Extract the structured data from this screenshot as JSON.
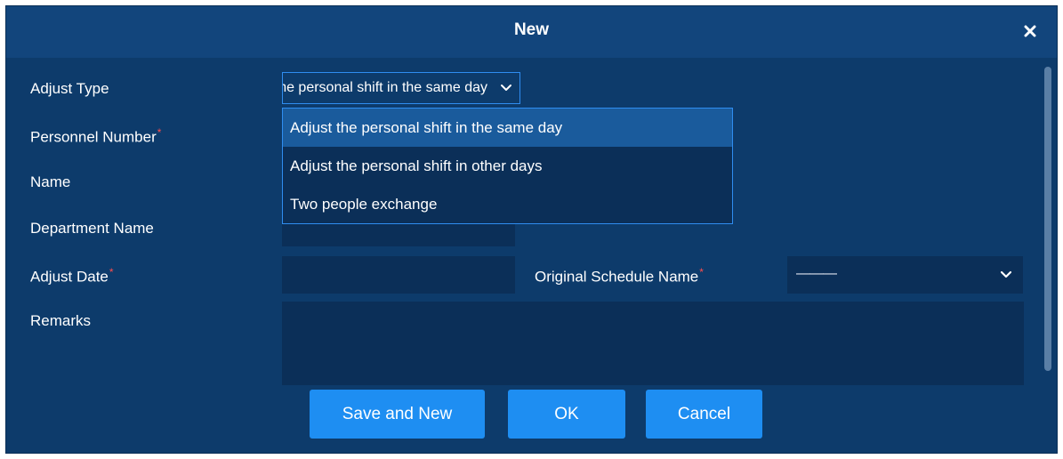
{
  "dialog": {
    "title": "New",
    "close_icon": "close-icon"
  },
  "form": {
    "adjust_type_label": "Adjust Type",
    "adjust_type_value": "Adjust the personal shift in the same day",
    "personnel_number_label": "Personnel Number",
    "name_label": "Name",
    "department_name_label": "Department Name",
    "adjust_date_label": "Adjust Date",
    "original_schedule_label": "Original Schedule Name",
    "original_schedule_value": "———",
    "remarks_label": "Remarks",
    "required_marker": "*"
  },
  "dropdown": {
    "options": [
      "Adjust the personal shift in the same day",
      "Adjust the personal shift in other days",
      "Two people exchange"
    ],
    "selected_index": 0
  },
  "buttons": {
    "save_and_new": "Save and New",
    "ok": "OK",
    "cancel": "Cancel"
  },
  "colors": {
    "dialog_bg": "#0d3b6b",
    "titlebar_bg": "#12457c",
    "field_bg": "#0b2f58",
    "accent": "#1e8ef2",
    "required": "#ff4d4d"
  }
}
